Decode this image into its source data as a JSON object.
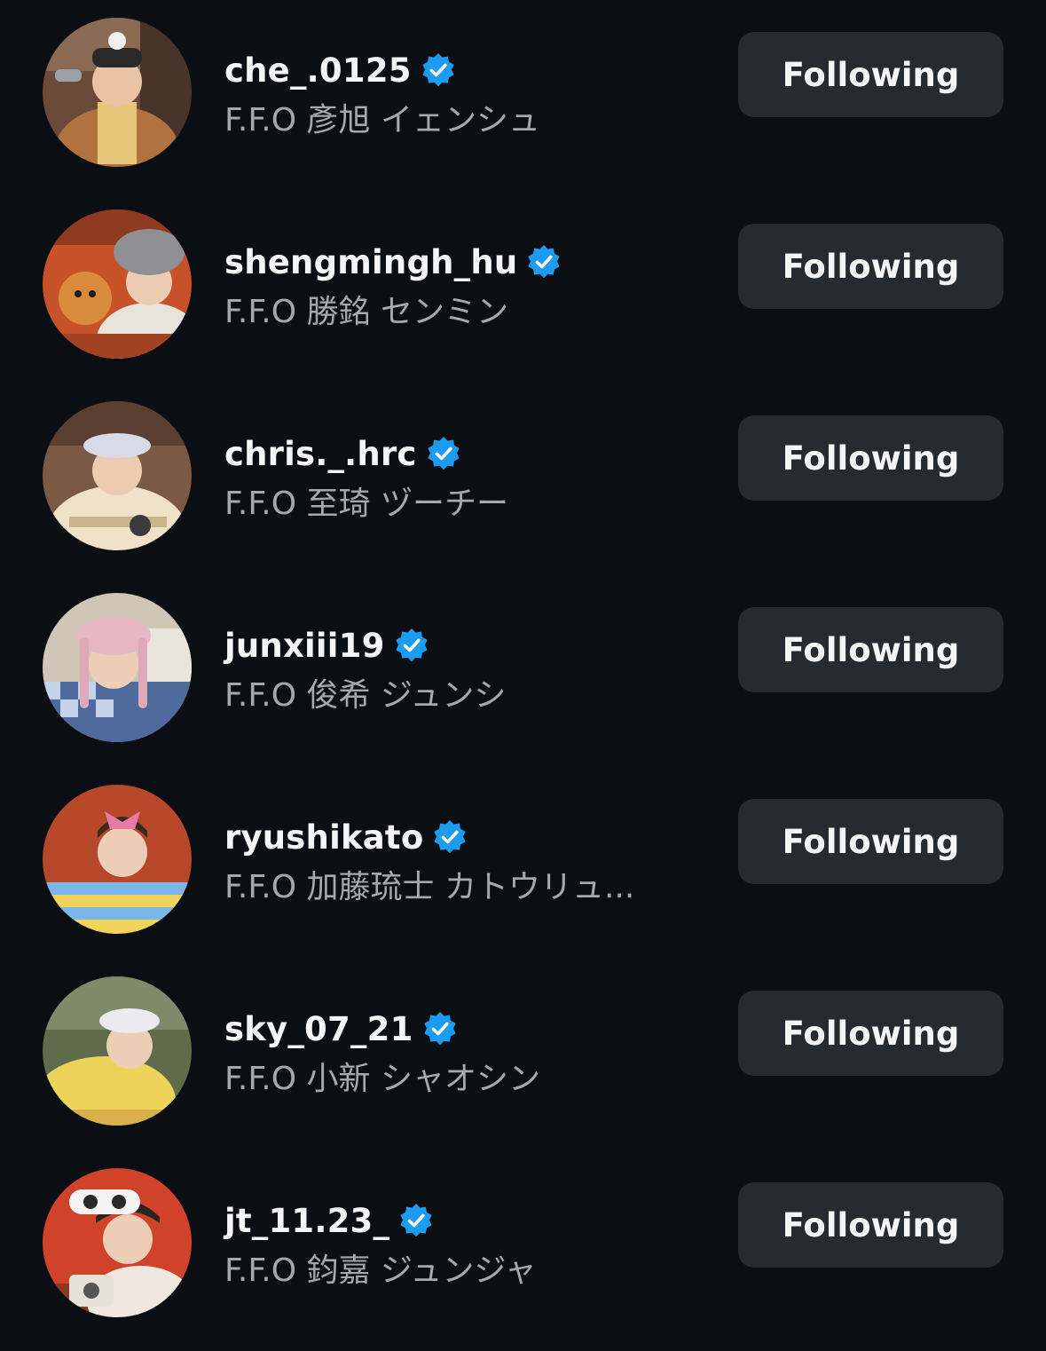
{
  "theme": {
    "background": "#0b0f14",
    "button_bg": "#262a31",
    "verified_blue": "#1d9bf0",
    "subtitle_color": "#a5a9ae"
  },
  "accounts": [
    {
      "username": "che_.0125",
      "display_name": "F.F.O 彥旭 イェンシュ",
      "verified": true,
      "button_label": "Following"
    },
    {
      "username": "shengmingh_hu",
      "display_name": "F.F.O 勝銘 センミン",
      "verified": true,
      "button_label": "Following"
    },
    {
      "username": "chris._.hrc",
      "display_name": "F.F.O 至琦 ヅーチー",
      "verified": true,
      "button_label": "Following"
    },
    {
      "username": "junxiii19",
      "display_name": "F.F.O 俊希 ジュンシ",
      "verified": true,
      "button_label": "Following"
    },
    {
      "username": "ryushikato",
      "display_name": "F.F.O 加藤琉士 カトウリュ...",
      "verified": true,
      "button_label": "Following"
    },
    {
      "username": "sky_07_21",
      "display_name": "F.F.O 小新 シャオシン",
      "verified": true,
      "button_label": "Following"
    },
    {
      "username": "jt_11.23_",
      "display_name": "F.F.O 鈞嘉 ジュンジャ",
      "verified": true,
      "button_label": "Following"
    }
  ]
}
